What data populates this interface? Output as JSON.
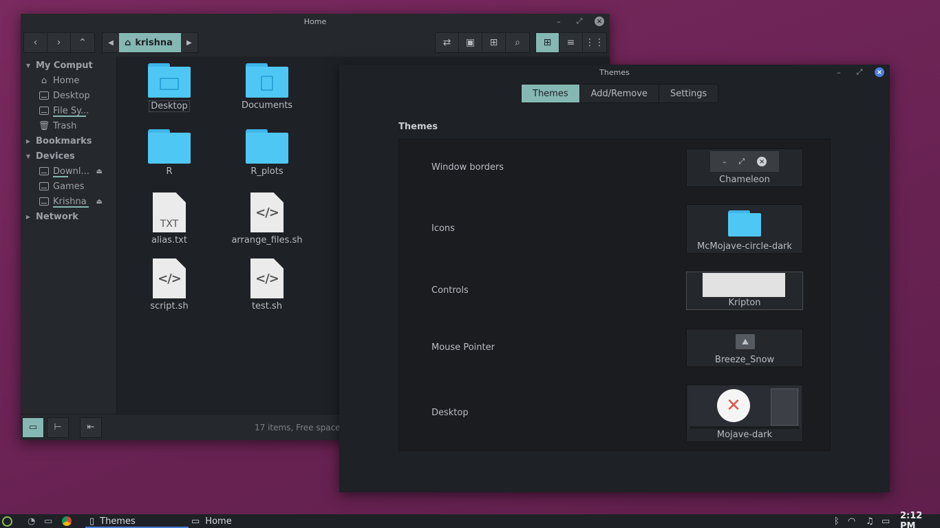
{
  "file_manager": {
    "title": "Home",
    "location": "krishna",
    "sidebar": {
      "sections": [
        {
          "label": "My Comput",
          "items": [
            "Home",
            "Desktop",
            "File Sy...",
            "Trash"
          ]
        },
        {
          "label": "Bookmarks",
          "items": []
        },
        {
          "label": "Devices",
          "items": [
            "Downl...",
            "Games",
            "Krishna"
          ]
        },
        {
          "label": "Network",
          "items": []
        }
      ]
    },
    "files": [
      {
        "name": "Desktop",
        "kind": "folder"
      },
      {
        "name": "Documents",
        "kind": "folder"
      },
      {
        "name": "R",
        "kind": "folder"
      },
      {
        "name": "R_plots",
        "kind": "folder"
      },
      {
        "name": "alias.txt",
        "kind": "text",
        "badge": "TXT"
      },
      {
        "name": "arrange_files.sh",
        "kind": "script",
        "badge": "</>"
      },
      {
        "name": "script.sh",
        "kind": "script",
        "badge": "</>"
      },
      {
        "name": "test.sh",
        "kind": "script",
        "badge": "</>"
      }
    ],
    "status": "17 items, Free space"
  },
  "themes_window": {
    "title": "Themes",
    "tabs": [
      "Themes",
      "Add/Remove",
      "Settings"
    ],
    "active_tab": "Themes",
    "section_title": "Themes",
    "rows": [
      {
        "label": "Window borders",
        "value": "Chameleon"
      },
      {
        "label": "Icons",
        "value": "McMojave-circle-dark"
      },
      {
        "label": "Controls",
        "value": "Kripton"
      },
      {
        "label": "Mouse Pointer",
        "value": "Breeze_Snow"
      },
      {
        "label": "Desktop",
        "value": "Mojave-dark"
      }
    ]
  },
  "taskbar": {
    "windows": [
      "Themes",
      "Home"
    ],
    "clock": "2:12 PM"
  },
  "colors": {
    "accent": "#86b8b3",
    "folder": "#4fc7f5",
    "desktop": "#6d2456"
  }
}
